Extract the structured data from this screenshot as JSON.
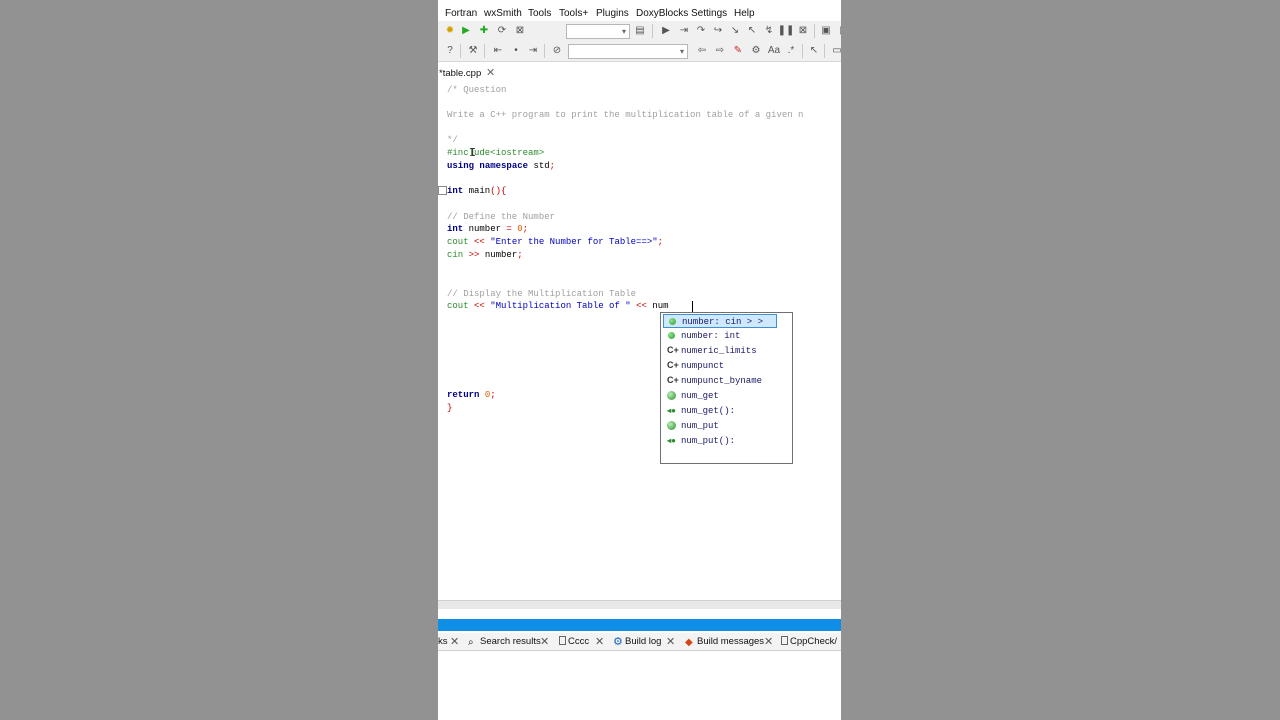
{
  "menu": [
    "Fortran",
    "wxSmith",
    "Tools",
    "Tools+",
    "Plugins",
    "DoxyBlocks",
    "Settings",
    "Help"
  ],
  "tab": {
    "filename": "*table.cpp",
    "close": "✕"
  },
  "code": [
    "/* Question",
    "",
    "Write a C++ program to print the multiplication table of a given n",
    "",
    "*/",
    "#include<iostream>",
    "using namespace std;",
    "",
    "int main(){",
    "",
    "// Define the Number",
    "int number = 0;",
    "cout << \"Enter the Number for Table==>\";",
    "cin >> number;",
    "",
    "",
    "// Display the Multiplication Table",
    "cout << \"Multiplication Table of \" << num",
    "",
    "",
    "",
    "",
    "",
    "",
    "return 0;",
    "}"
  ],
  "autocomplete": [
    {
      "icon": "variable",
      "text": "number: cin > >",
      "selected": true
    },
    {
      "icon": "variable",
      "text": "number: int",
      "selected": false
    },
    {
      "icon": "class",
      "text": "numeric_limits",
      "selected": false
    },
    {
      "icon": "class",
      "text": "numpunct",
      "selected": false
    },
    {
      "icon": "class",
      "text": "numpunct_byname",
      "selected": false
    },
    {
      "icon": "namespace",
      "text": "num_get",
      "selected": false
    },
    {
      "icon": "function",
      "text": "num_get():",
      "selected": false
    },
    {
      "icon": "namespace",
      "text": "num_put",
      "selected": false
    },
    {
      "icon": "function",
      "text": "num_put():",
      "selected": false
    }
  ],
  "log_tabs": [
    {
      "label": "ks",
      "icon": ""
    },
    {
      "label": "Search results",
      "icon": "search-icon"
    },
    {
      "label": "Cccc",
      "icon": "doc-icon"
    },
    {
      "label": "Build log",
      "icon": "gear-icon"
    },
    {
      "label": "Build messages",
      "icon": "pin-icon"
    },
    {
      "label": "CppCheck/",
      "icon": "doc-icon"
    }
  ],
  "colors": {
    "comment": "#a0a0a0",
    "preprocessor": "#2e8b2e",
    "keyword": "#00008b",
    "string": "#0000c0",
    "number": "#e05a00",
    "accent_bar": "#0f8ee8"
  }
}
